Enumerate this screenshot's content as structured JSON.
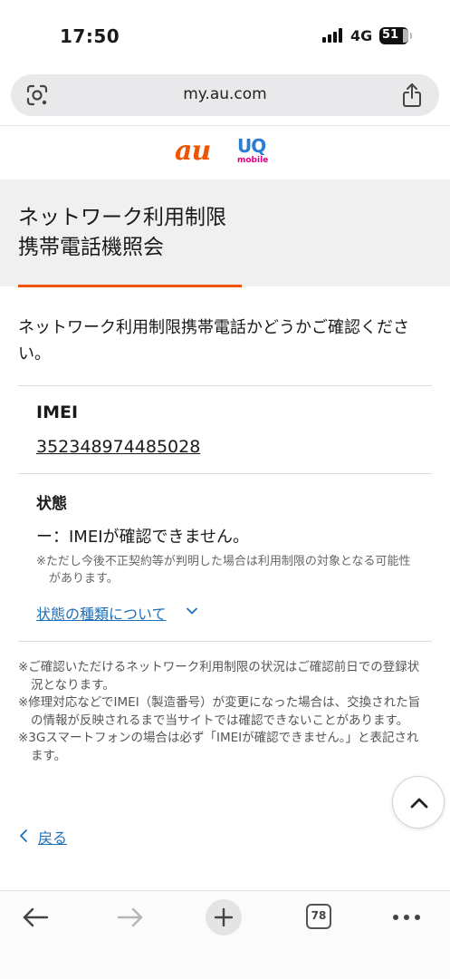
{
  "status_bar": {
    "time": "17:50",
    "network": "4G",
    "battery": "51"
  },
  "browser": {
    "url": "my.au.com",
    "tab_count": "78"
  },
  "brand": {
    "au": "au",
    "uq": "UQ",
    "uq_sub": "mobile",
    "au_color": "#eb5505",
    "uq_color": "#2b7cd6"
  },
  "page": {
    "title_line1": "ネットワーク利用制限",
    "title_line2": "携帯電話機照会",
    "intro": "ネットワーク利用制限携帯電話かどうかご確認ください。",
    "imei_label": "IMEI",
    "imei_value": "352348974485028",
    "status_label": "状態",
    "status_value": "ー：IMEIが確認できません。",
    "status_note": "※ただし今後不正契約等が判明した場合は利用制限の対象となる可能性があります。",
    "status_link": "状態の種類について",
    "notes": [
      "※ご確認いただけるネットワーク利用制限の状況はご確認前日での登録状況となります。",
      "※修理対応などでIMEI（製造番号）が変更になった場合は、交換された旨の情報が反映されるまで当サイトでは確認できないことがあります。",
      "※3Gスマートフォンの場合は必ず「IMEIが確認できません。」と表記されます。"
    ],
    "back": "戻る"
  },
  "icons": {
    "lens": "lens-icon",
    "share": "share-icon",
    "scroll_top": "chevron-up-icon",
    "back_nav": "arrow-left-icon",
    "forward_nav": "arrow-right-icon",
    "new_tab": "plus-icon",
    "more": "more-icon"
  }
}
